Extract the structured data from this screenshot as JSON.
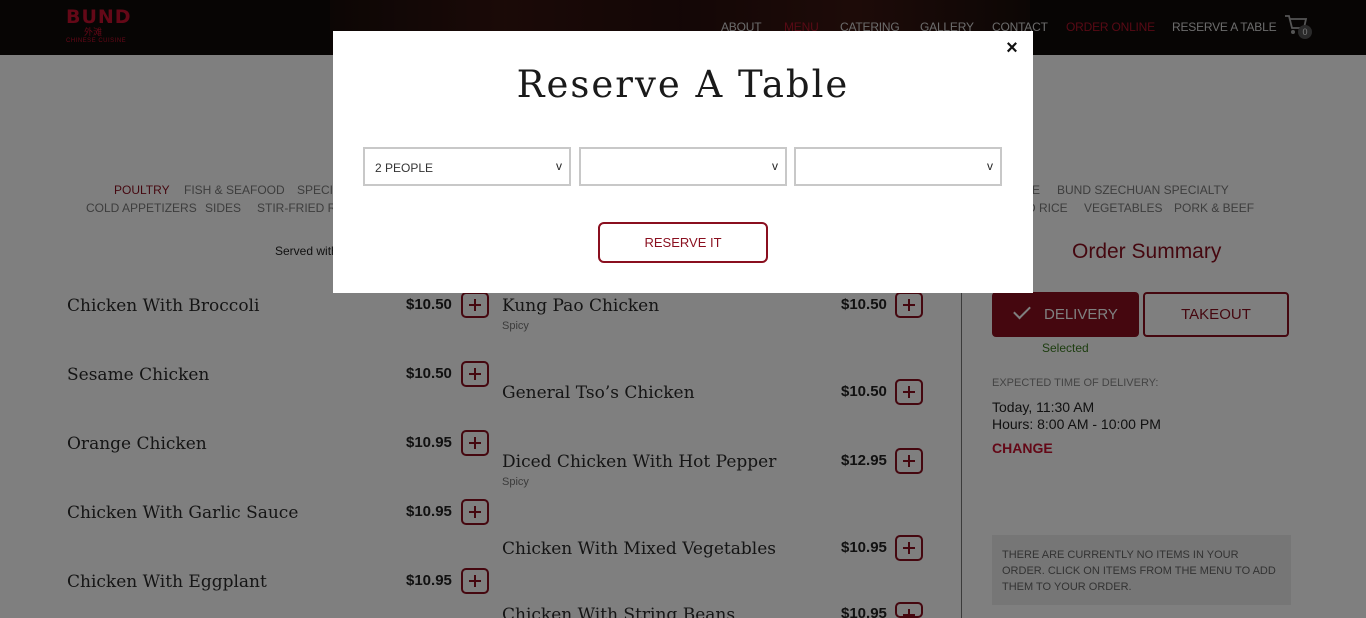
{
  "brand": {
    "name": "BUND",
    "chinese": "外滩",
    "sub": "CHINESE CUISINE"
  },
  "nav": [
    {
      "label": "ABOUT",
      "active": false
    },
    {
      "label": "MENU",
      "active": true
    },
    {
      "label": "CATERING",
      "active": false
    },
    {
      "label": "GALLERY",
      "active": false
    },
    {
      "label": "CONTACT",
      "active": false
    },
    {
      "label": "ORDER ONLINE",
      "active": true
    },
    {
      "label": "RESERVE A TABLE",
      "active": false
    }
  ],
  "cart": {
    "count": "0"
  },
  "categories_row1": [
    "POULTRY",
    "FISH & SEAFOOD",
    "SPECI",
    "E",
    "BUND SZECHUAN SPECIALTY"
  ],
  "categories_row2": [
    "COLD APPETIZERS",
    "SIDES",
    "STIR-FRIED RIC",
    "D RICE",
    "VEGETABLES",
    "PORK & BEEF"
  ],
  "served_note": "Served with",
  "menu_left": [
    {
      "name": "Chicken With Broccoli",
      "price": "$10.50",
      "note": ""
    },
    {
      "name": "Sesame Chicken",
      "price": "$10.50",
      "note": ""
    },
    {
      "name": "Orange Chicken",
      "price": "$10.95",
      "note": ""
    },
    {
      "name": "Chicken With Garlic Sauce",
      "price": "$10.95",
      "note": ""
    },
    {
      "name": "Chicken With Eggplant",
      "price": "$10.95",
      "note": ""
    }
  ],
  "menu_right": [
    {
      "name": "Kung Pao Chicken",
      "price": "$10.50",
      "note": "Spicy"
    },
    {
      "name": "General Tso’s Chicken",
      "price": "$10.50",
      "note": ""
    },
    {
      "name": "Diced Chicken With Hot Pepper",
      "price": "$12.95",
      "note": "Spicy"
    },
    {
      "name": "Chicken With Mixed Vegetables",
      "price": "$10.95",
      "note": ""
    },
    {
      "name": "Chicken With String Beans",
      "price": "$10.95",
      "note": ""
    }
  ],
  "summary": {
    "title": "Order Summary",
    "delivery_label": "DELIVERY",
    "takeout_label": "TAKEOUT",
    "selected_label": "Selected",
    "expected_label": "EXPECTED TIME OF DELIVERY:",
    "expected_time": "Today, 11:30 AM",
    "hours": "Hours: 8:00 AM - 10:00 PM",
    "change_label": "CHANGE",
    "empty_message": "THERE ARE CURRENTLY NO ITEMS IN YOUR ORDER. CLICK ON ITEMS FROM THE MENU TO ADD THEM TO YOUR ORDER."
  },
  "modal": {
    "title": "Reserve A Table",
    "close_glyph": "×",
    "party_value": "2 PEOPLE",
    "date_value": "",
    "time_value": "",
    "chevron": "v",
    "reserve_label": "RESERVE IT"
  },
  "colors": {
    "accent": "#8a0f1f",
    "brand_red": "#c8102e",
    "header_bg": "#0f0a08",
    "selected_green": "#3a7a20"
  }
}
